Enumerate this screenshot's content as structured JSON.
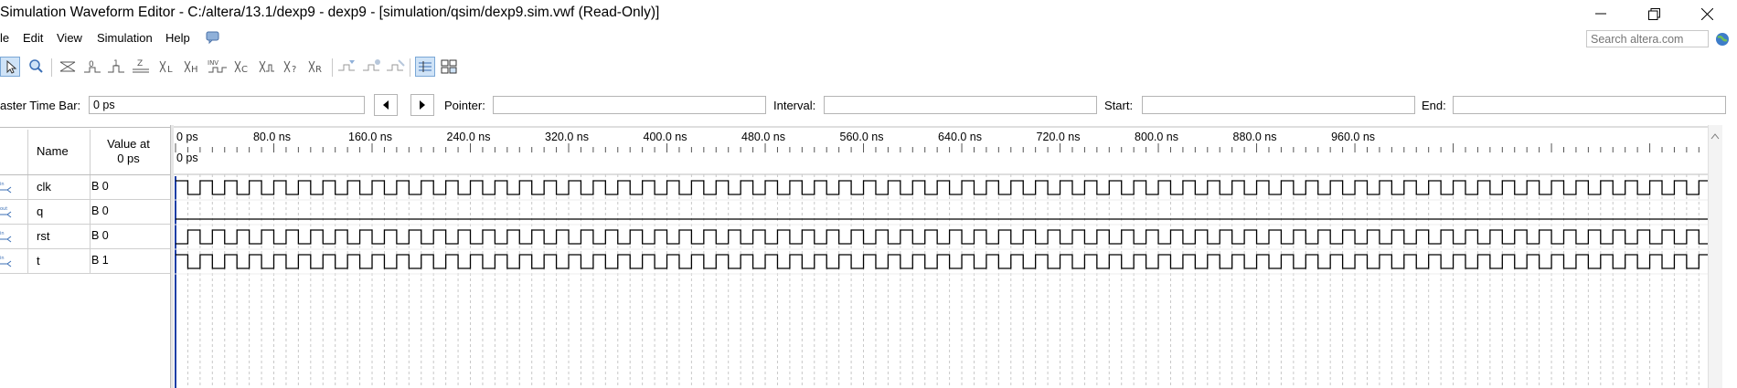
{
  "window": {
    "title": "Simulation Waveform Editor - C:/altera/13.1/dexp9 - dexp9 - [simulation/qsim/dexp9.sim.vwf (Read-Only)]"
  },
  "menu": {
    "file": "le",
    "edit": "Edit",
    "view": "View",
    "simulation": "Simulation",
    "help": "Help"
  },
  "search": {
    "placeholder": "Search altera.com"
  },
  "toolbar": {
    "tools": [
      "selection-tool-icon",
      "zoom-tool-icon",
      "force-unknown-icon",
      "force-low-icon",
      "force-high-icon",
      "force-high-impedance-icon",
      "force-weak-low-icon",
      "force-weak-high-icon",
      "invert-icon",
      "count-value-icon",
      "clock-value-icon",
      "random-value-icon",
      "arbitrary-value-icon",
      "snap-to-grid-icon",
      "grid-settings-icon"
    ]
  },
  "timebar": {
    "master_label": "aster Time Bar:",
    "master_value": "0 ps",
    "pointer_label": "Pointer:",
    "pointer_value": "",
    "interval_label": "Interval:",
    "interval_value": "",
    "start_label": "Start:",
    "start_value": "",
    "end_label": "End:",
    "end_value": ""
  },
  "columns": {
    "name": "Name",
    "value_line1": "Value at",
    "value_line2": "0 ps"
  },
  "signals": [
    {
      "name": "clk",
      "value": "B 0",
      "type": "input",
      "initial": 1,
      "period_ns": 20
    },
    {
      "name": "q",
      "value": "B 0",
      "type": "output",
      "initial": 0,
      "period_ns": 0
    },
    {
      "name": "rst",
      "value": "B 0",
      "type": "input",
      "initial": 0,
      "period_ns": 20
    },
    {
      "name": "t",
      "value": "B 1",
      "type": "input",
      "initial": 1,
      "period_ns": 20
    }
  ],
  "timeline": {
    "ticks": [
      "0 ps",
      "80.0 ns",
      "160.0 ns",
      "240.0 ns",
      "320.0 ns",
      "400.0 ns",
      "480.0 ns",
      "560.0 ns",
      "640.0 ns",
      "720.0 ns",
      "800.0 ns",
      "880.0 ns",
      "960.0 ns"
    ],
    "cursor_label": "0 ps",
    "visible_span_ns": 1000
  },
  "colors": {
    "accent": "#3b6fb6",
    "cursor": "#1e3fa6",
    "wave": "#000000",
    "grid": "#c8c8c8",
    "active_tool": "#cfe3f7"
  }
}
